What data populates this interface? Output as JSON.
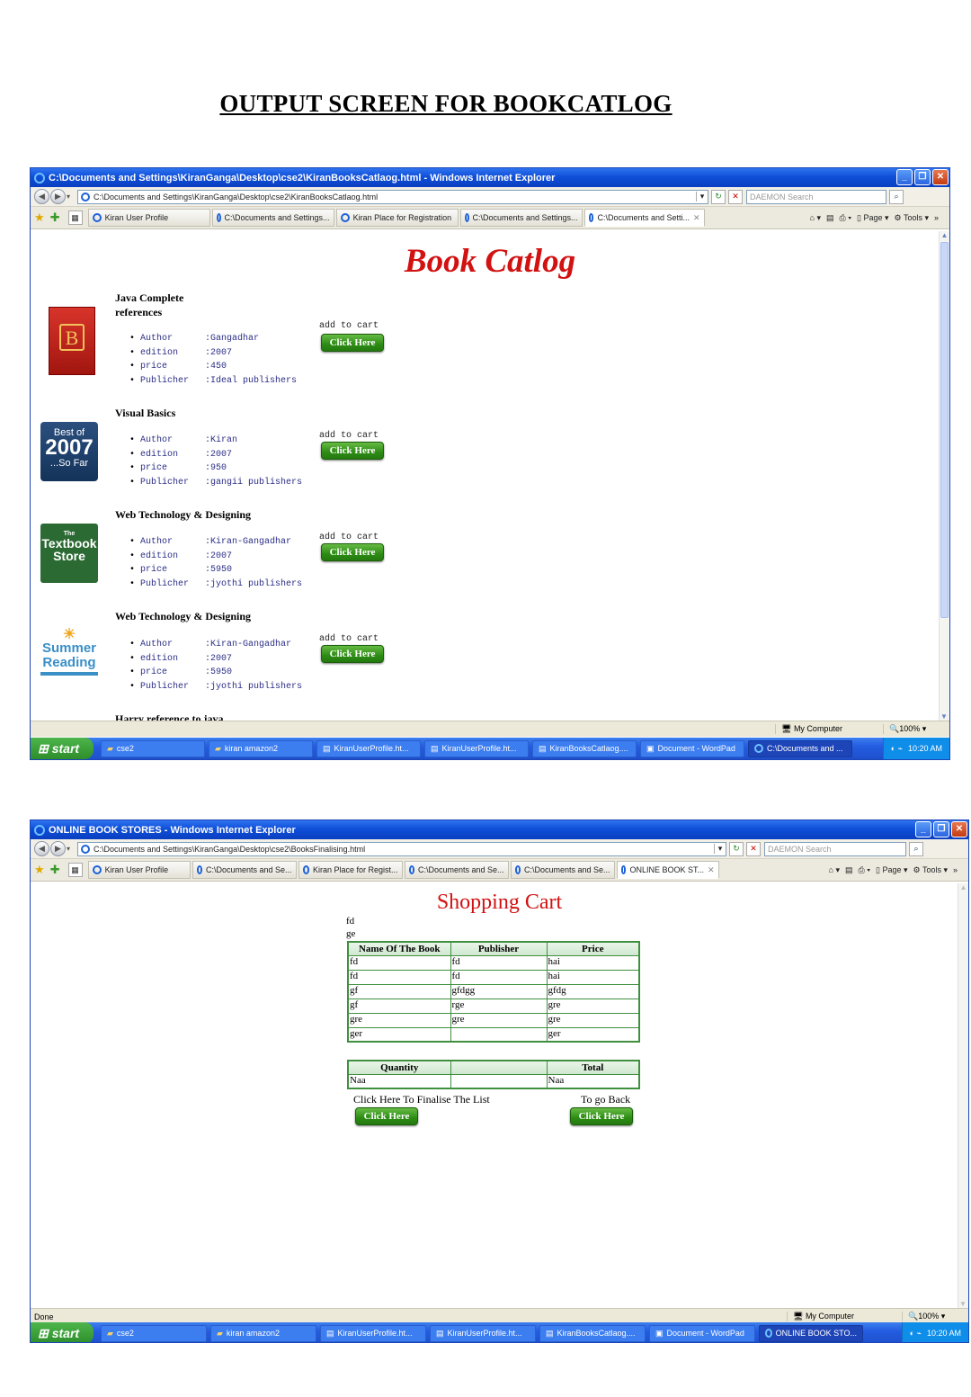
{
  "document_title": "OUTPUT SCREEN  FOR BOOKCATLOG",
  "window1": {
    "title": "C:\\Documents and Settings\\KiranGanga\\Desktop\\cse2\\KiranBooksCatlaog.html - Windows Internet Explorer",
    "address": "C:\\Documents and Settings\\KiranGanga\\Desktop\\cse2\\KiranBooksCatlaog.html",
    "search_placeholder": "DAEMON Search",
    "tabs": [
      "Kiran User Profile",
      "C:\\Documents and Settings...",
      "Kiran Place for Registration",
      "C:\\Documents and Settings...",
      "C:\\Documents and Setti..."
    ],
    "tools": {
      "page": "Page",
      "tools": "Tools"
    },
    "page": {
      "heading": "Book Catlog",
      "attr_labels": [
        "Author",
        "edition",
        "price",
        "Publicher"
      ],
      "cart_label": "add to cart",
      "button_label": "Click Here",
      "books": [
        {
          "title": "Java Complete references",
          "image": "java-book-cover",
          "author": ":Gangadhar",
          "edition": ":2007",
          "price": ":450",
          "publisher": ":Ideal publishers"
        },
        {
          "title": "Visual Basics",
          "image": "best-of-2007-badge",
          "author": ":Kiran",
          "edition": ":2007",
          "price": ":950",
          "publisher": ":gangii publishers"
        },
        {
          "title": "Web Technology & Designing",
          "image": "textbook-store-logo",
          "author": ":Kiran-Gangadhar",
          "edition": ":2007",
          "price": ":5950",
          "publisher": ":jyothi publishers"
        },
        {
          "title": "Web Technology & Designing",
          "image": "summer-reading-logo",
          "author": ":Kiran-Gangadhar",
          "edition": ":2007",
          "price": ":5950",
          "publisher": ":jyothi publishers"
        }
      ],
      "partial_next_title": "Harry reference to java",
      "badge_texts": {
        "best_of": "Best of",
        "year": "2007",
        "so_far": "...So Far",
        "the": "The",
        "textbook": "Textbook",
        "store": "Store",
        "summer": "Summer",
        "reading": "Reading"
      }
    },
    "status": {
      "zone": "My Computer",
      "zoom": "100%"
    },
    "taskbar": {
      "start": "start",
      "items": [
        "cse2",
        "kiran amazon2",
        "KiranUserProfile.ht...",
        "KiranUserProfile.ht...",
        "KiranBooksCatlaog....",
        "Document - WordPad",
        "C:\\Documents and ..."
      ],
      "time": "10:20 AM"
    }
  },
  "window2": {
    "title": "ONLINE BOOK STORES - Windows Internet Explorer",
    "address": "C:\\Documents and Settings\\KiranGanga\\Desktop\\cse2\\BooksFinalising.html",
    "search_placeholder": "DAEMON Search",
    "tabs": [
      "Kiran User Profile",
      "C:\\Documents and Se...",
      "Kiran Place for Regist...",
      "C:\\Documents and Se...",
      "C:\\Documents and Se...",
      "ONLINE BOOK ST..."
    ],
    "tools": {
      "page": "Page",
      "tools": "Tools"
    },
    "page": {
      "heading": "Shopping Cart",
      "line1": "fd",
      "line2": "ge",
      "table_headers": [
        "Name Of The Book",
        "Publisher",
        "Price"
      ],
      "rows": [
        [
          "fd",
          "fd",
          "hai"
        ],
        [
          "fd",
          "fd",
          "hai"
        ],
        [
          "gf",
          "gfdgg",
          "gfdg"
        ],
        [
          "gf",
          "rge",
          "gre"
        ],
        [
          "gre",
          "gre",
          "gre"
        ],
        [
          "ger",
          "",
          "ger"
        ]
      ],
      "totals_headers": [
        "Quantity",
        "",
        "Total"
      ],
      "totals_row": [
        "Naa",
        "",
        "Naa"
      ],
      "finalise_label": "Click Here To Finalise The List",
      "back_label": "To go Back",
      "button_label": "Click Here"
    },
    "status": {
      "left": "Done",
      "zone": "My Computer",
      "zoom": "100%"
    },
    "taskbar": {
      "start": "start",
      "items": [
        "cse2",
        "kiran amazon2",
        "KiranUserProfile.ht...",
        "KiranUserProfile.ht...",
        "KiranBooksCatlaog....",
        "Document - WordPad",
        "ONLINE BOOK STO..."
      ],
      "time": "10:20 AM"
    }
  }
}
